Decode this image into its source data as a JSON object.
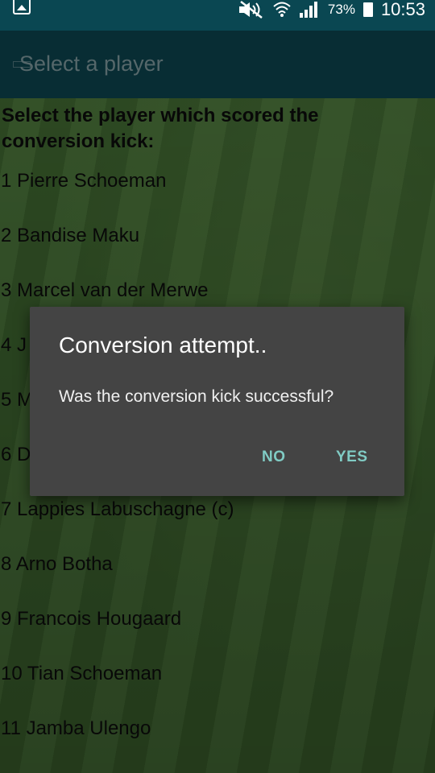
{
  "status_bar": {
    "battery_percent": "73%",
    "time": "10:53",
    "icons": [
      "image-icon",
      "mute-icon",
      "wifi-icon",
      "signal-icon",
      "battery-icon"
    ]
  },
  "app_bar": {
    "title": "Select a player"
  },
  "content": {
    "instruction": "Select the player which scored the conversion kick:",
    "players": [
      "1 Pierre Schoeman",
      "2 Bandise Maku",
      "3 Marcel van der Merwe",
      "4 J",
      "5 M",
      "6 D",
      "7 Lappies Labuschagne (c)",
      "8 Arno Botha",
      "9 Francois Hougaard",
      "10 Tian Schoeman",
      "11 Jamba Ulengo"
    ]
  },
  "dialog": {
    "title": "Conversion attempt..",
    "message": "Was the conversion kick successful?",
    "negative_label": "NO",
    "positive_label": "YES"
  },
  "colors": {
    "status_bar": "#0a4752",
    "app_bar": "#0d4a55",
    "dialog_bg": "#444444",
    "dialog_button": "#80cbc4"
  }
}
